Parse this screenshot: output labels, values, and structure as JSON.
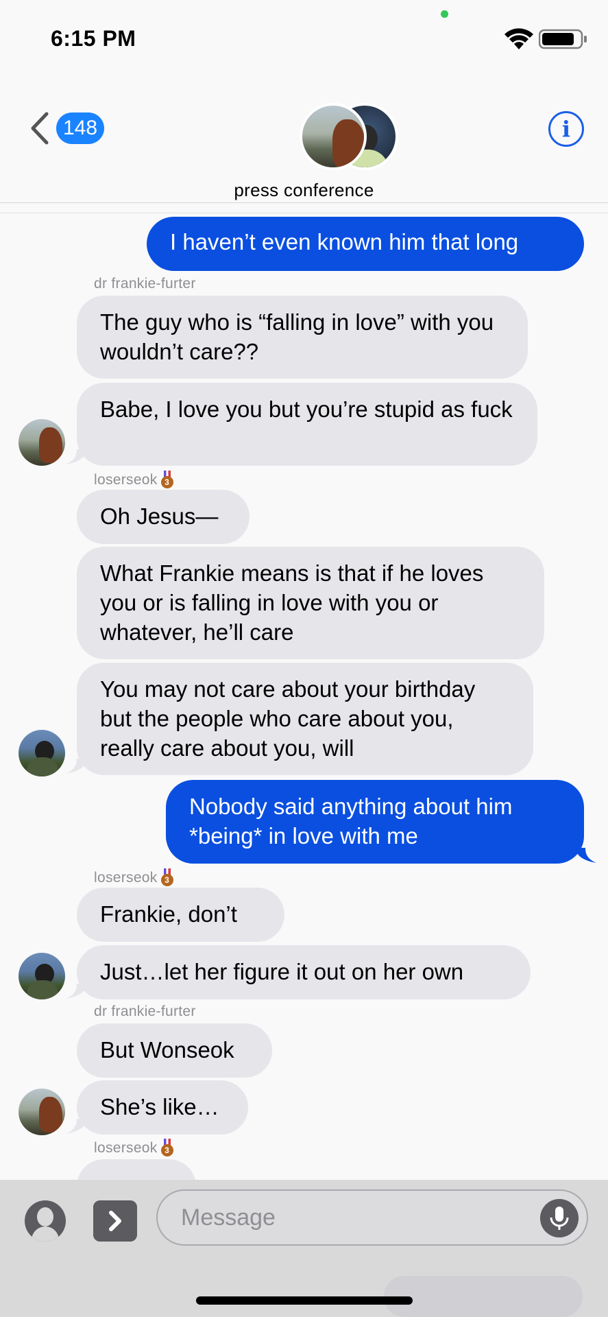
{
  "status_bar": {
    "time": "6:15 PM",
    "wifi_icon": "wifi-icon",
    "battery_icon": "battery-icon"
  },
  "header": {
    "back_count": "148",
    "title": "press conference",
    "info_icon_glyph": "i"
  },
  "messages": [
    {
      "kind": "out",
      "text": "I haven’t even known him that long"
    },
    {
      "kind": "sender",
      "text": "dr frankie-furter"
    },
    {
      "kind": "in",
      "text": "The guy who is “falling in love” with you wouldn’t care??"
    },
    {
      "kind": "in",
      "text": "Babe, I love you but you’re stupid as fuck"
    },
    {
      "kind": "sender",
      "text": "loserseok"
    },
    {
      "kind": "in",
      "text": "Oh Jesus—"
    },
    {
      "kind": "in",
      "text": "What Frankie means is that if he loves you or is falling in love with you or whatever, he’ll care"
    },
    {
      "kind": "in",
      "text": "You may not care about your birthday but the people who care about you, really care about you, will"
    },
    {
      "kind": "out",
      "text": "Nobody said anything about him *being* in love with me"
    },
    {
      "kind": "sender",
      "text": "loserseok"
    },
    {
      "kind": "in",
      "text": "Frankie, don’t"
    },
    {
      "kind": "in",
      "text": "Just…let her figure it out on her own"
    },
    {
      "kind": "sender",
      "text": "dr frankie-furter"
    },
    {
      "kind": "in",
      "text": "But Wonseok"
    },
    {
      "kind": "in",
      "text": "She’s like…"
    },
    {
      "kind": "sender",
      "text": "loserseok"
    }
  ],
  "medal_number": "3",
  "composer": {
    "placeholder": "Message"
  },
  "colors": {
    "outgoing_bubble": "#0a4fe0",
    "incoming_bubble": "#e6e5ea",
    "accent": "#1a83ff"
  }
}
